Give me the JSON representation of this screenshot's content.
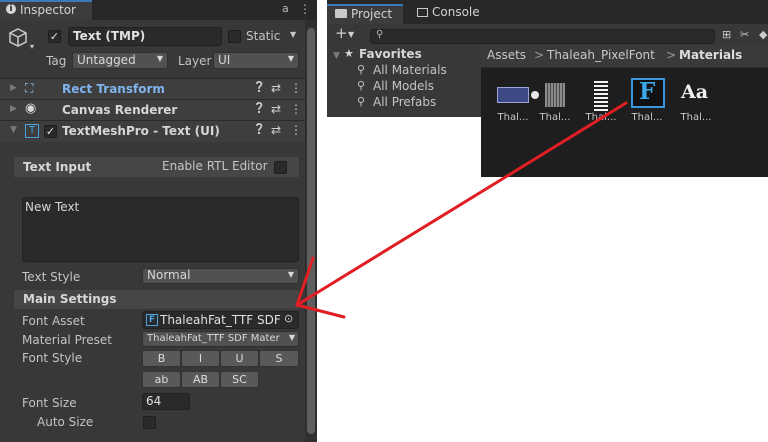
{
  "inspector": {
    "tab_title": "Inspector",
    "tab_icon": "info-icon",
    "object_name": "Text (TMP)",
    "static_label": "Static",
    "tag_label": "Tag",
    "tag_value": "Untagged",
    "layer_label": "Layer",
    "layer_value": "UI",
    "components": [
      {
        "name": "Rect Transform"
      },
      {
        "name": "Canvas Renderer"
      },
      {
        "name": "TextMeshPro - Text (UI)"
      }
    ],
    "text_input": {
      "header": "Text Input",
      "rtl_label": "Enable RTL Editor",
      "value": "New Text"
    },
    "text_style": {
      "label": "Text Style",
      "value": "Normal"
    },
    "main_settings": "Main Settings",
    "font_asset": {
      "label": "Font Asset",
      "value": "ThaleahFat_TTF SDF"
    },
    "material_preset": {
      "label": "Material Preset",
      "value": "ThaleahFat_TTF SDF Mater"
    },
    "font_style": {
      "label": "Font Style",
      "row1": [
        "B",
        "I",
        "U",
        "S"
      ],
      "row2": [
        "ab",
        "AB",
        "SC"
      ]
    },
    "font_size": {
      "label": "Font Size",
      "value": "64"
    },
    "auto_size": {
      "label": "Auto Size"
    },
    "help_glyph": "❓",
    "settings_glyph": "⇄",
    "more_glyph": "⋮"
  },
  "project": {
    "tabs": [
      "Project",
      "Console"
    ],
    "plus": "+",
    "favorites_title": "Favorites",
    "favorites": [
      "All Materials",
      "All Models",
      "All Prefabs"
    ],
    "breadcrumb": {
      "root": "Assets",
      "sep": ">",
      "mid": "Thaleah_PixelFont",
      "leaf": "Materials"
    },
    "assets": [
      {
        "label": "Thal...",
        "kind": "material-bar"
      },
      {
        "label": "Thal...",
        "kind": "noise"
      },
      {
        "label": "Thal...",
        "kind": "atlas"
      },
      {
        "label": "Thal...",
        "kind": "font-asset"
      },
      {
        "label": "Thal...",
        "kind": "font"
      }
    ],
    "font_asset_glyph": "F",
    "font_glyph": "Aa"
  },
  "colors": {
    "panel": "#383838",
    "accent": "#3a79bb",
    "arrow": "#e11e24"
  }
}
